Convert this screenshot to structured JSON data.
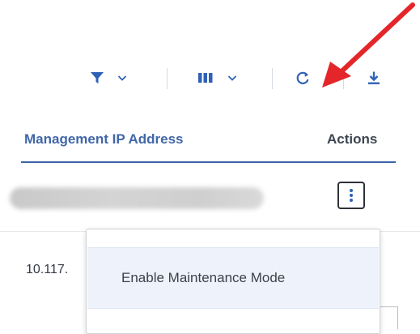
{
  "toolbar": {
    "icons": {
      "filter": "filter-icon",
      "filter_caret": "chevron-down-icon",
      "columns": "columns-icon",
      "columns_caret": "chevron-down-icon",
      "refresh": "refresh-icon",
      "download": "download-icon"
    },
    "icon_color": "#2f62b6",
    "caret_color": "#2f62b6"
  },
  "annotation": {
    "arrow_color": "#e4262a",
    "points_to": "refresh-button"
  },
  "table": {
    "columns": [
      {
        "label": "Management IP Address",
        "color": "#4167a8"
      },
      {
        "label": "Actions",
        "color": "#3d4652"
      }
    ],
    "header_underline_color": "#3d63a8",
    "rows": [
      {
        "ip": "",
        "ip_redacted": true,
        "actions_icon": "kebab-menu-icon"
      },
      {
        "ip": "10.117."
      }
    ]
  },
  "dropdown": {
    "items": [
      {
        "label": "Enable Maintenance Mode"
      }
    ]
  }
}
